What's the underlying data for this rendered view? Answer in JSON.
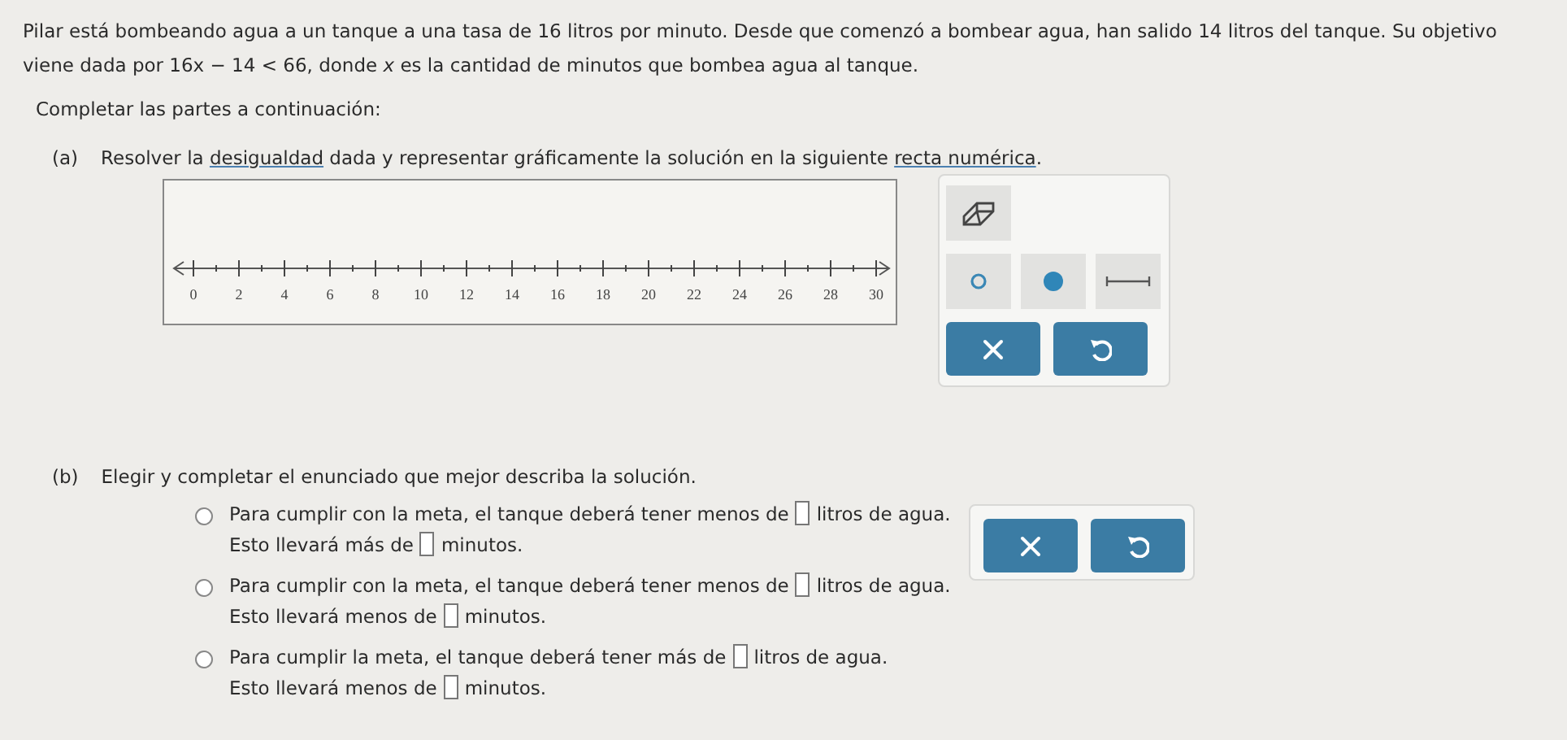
{
  "problem": {
    "statement": "Pilar está bombeando agua a un tanque a una tasa de 16 litros por minuto. Desde que comenzó a bombear agua, han salido 14 litros del tanque. Su objetivo viene dada por 16x − 14 < 66, donde *x* es la cantidad de minutos que bombea agua al tanque.",
    "instruction": "Completar las partes a continuación:"
  },
  "part_a": {
    "label": "(a)",
    "text": [
      {
        "kind": "plain",
        "text": "Resolver la "
      },
      {
        "kind": "link",
        "text": "desigualdad"
      },
      {
        "kind": "plain",
        "text": " dada y representar gráficamente la solución en la siguiente "
      },
      {
        "kind": "link",
        "text": "recta numérica"
      },
      {
        "kind": "plain",
        "text": "."
      }
    ],
    "number_line": {
      "labels": [
        "0",
        "2",
        "4",
        "6",
        "8",
        "10",
        "12",
        "14",
        "16",
        "18",
        "20",
        "22",
        "24",
        "26",
        "28",
        "30"
      ]
    },
    "tools": [
      {
        "kind": "eraser"
      },
      {
        "kind": "open-dot"
      },
      {
        "kind": "closed-dot"
      },
      {
        "kind": "segment"
      }
    ],
    "buttons": [
      {
        "kind": "clear"
      },
      {
        "kind": "undo"
      }
    ]
  },
  "part_b": {
    "label": "(b)",
    "prompt": "Elegir y completar el enunciado que mejor describa la solución.",
    "options": [
      {
        "selected": false,
        "line1_before": "Para cumplir con la meta, el tanque deberá tener menos de",
        "line1_after": "litros de agua.",
        "line2_before": "Esto llevará más de",
        "line2_after": "minutos."
      },
      {
        "selected": false,
        "line1_before": "Para cumplir con la meta, el tanque deberá tener menos de",
        "line1_after": "litros de agua.",
        "line2_before": "Esto llevará menos de",
        "line2_after": "minutos."
      },
      {
        "selected": false,
        "line1_before": "Para cumplir la meta, el tanque deberá tener más de",
        "line1_after": "litros de agua.",
        "line2_before": "Esto llevará menos de",
        "line2_after": "minutos."
      }
    ],
    "buttons": [
      {
        "kind": "clear"
      },
      {
        "kind": "undo"
      }
    ]
  }
}
